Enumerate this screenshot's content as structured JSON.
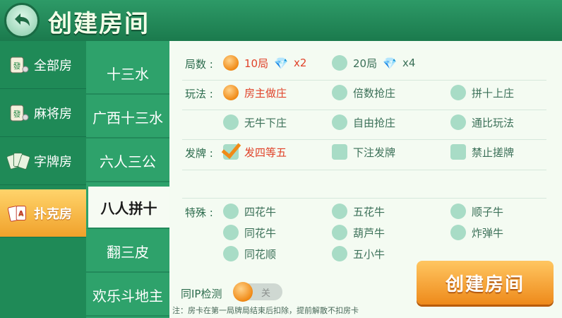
{
  "header": {
    "title": "创建房间"
  },
  "categories": [
    {
      "label": "全部房",
      "icon": "mahjong-tile-icon"
    },
    {
      "label": "麻将房",
      "icon": "mahjong-tile-icon"
    },
    {
      "label": "字牌房",
      "icon": "word-cards-icon"
    },
    {
      "label": "扑克房",
      "icon": "poker-cards-icon",
      "active": true
    }
  ],
  "sub_games": [
    "十三水",
    "广西十三水",
    "六人三公",
    "八人拼十",
    "翻三皮",
    "欢乐斗地主"
  ],
  "active_sub_game": "八人拼十",
  "options": {
    "rounds": {
      "label": "局数 :",
      "items": [
        {
          "text": "10局",
          "mult": "x2",
          "selected": true
        },
        {
          "text": "20局",
          "mult": "x4",
          "selected": false
        }
      ]
    },
    "mode": {
      "label": "玩法 :",
      "items": [
        "房主做庄",
        "倍数抢庄",
        "拼十上庄",
        "无牛下庄",
        "自由抢庄",
        "通比玩法"
      ],
      "selected": "房主做庄"
    },
    "deal": {
      "label": "发牌 :",
      "items": [
        "发四等五",
        "下注发牌",
        "禁止搓牌"
      ],
      "selected": "发四等五"
    },
    "special": {
      "label": "特殊 :",
      "items": [
        "四花牛",
        "五花牛",
        "顺子牛",
        "同花牛",
        "葫芦牛",
        "炸弹牛",
        "同花顺",
        "五小牛"
      ]
    }
  },
  "ip_check": {
    "label": "同IP检测",
    "state": "关"
  },
  "note": "注：房卡在第一局牌局结束后扣除，提前解散不扣房卡",
  "create_button": "创建房间",
  "colors": {
    "accent_orange": "#f08a16",
    "green": "#2ea26b",
    "selected_text": "#e0432a"
  }
}
